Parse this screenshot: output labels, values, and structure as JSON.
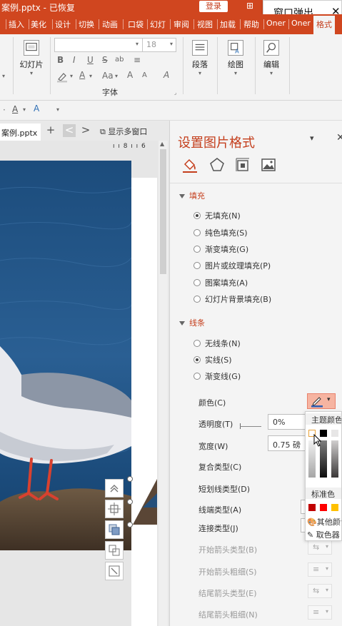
{
  "titlebar": {
    "document_title": "案例.pptx - 已恢复",
    "login_label": "登录",
    "restore_glyph": "⊞",
    "popup_label": "窗口弹出",
    "popup_close": "✕",
    "bg_color": "#d0461f"
  },
  "ribbon_tabs": [
    {
      "label": "插入"
    },
    {
      "label": "美化"
    },
    {
      "label": "设计"
    },
    {
      "label": "切换"
    },
    {
      "label": "动画"
    },
    {
      "label": "口袋"
    },
    {
      "label": "幻灯"
    },
    {
      "label": "审阅"
    },
    {
      "label": "视图"
    },
    {
      "label": "加载"
    },
    {
      "label": "帮助"
    },
    {
      "label": "Oner"
    },
    {
      "label": "Oner"
    },
    {
      "label": "格式"
    }
  ],
  "ribbon": {
    "slides_button": "幻灯片",
    "font_name_value": "",
    "font_size_value": "18",
    "font_group_label": "字体",
    "paragraph_button": "段落",
    "drawing_button": "绘图",
    "editing_button": "编辑",
    "bold": "B",
    "italic": "I",
    "underline": "U",
    "strike": "S",
    "shadow": "ab",
    "font_color": "A",
    "char_spacing": "Aa",
    "grow_font": "A",
    "shrink_font": "A",
    "clear_format": "A"
  },
  "doc_tabs": {
    "active_doc": "案例.pptx",
    "add_symbol": "+",
    "prev_symbol": "<",
    "next_symbol": ">",
    "multiwindow_label": "显示多窗口"
  },
  "ruler_text": "ı ı 8 ı ı 6",
  "panel": {
    "title": "设置图片格式",
    "dropdown_symbol": "▾",
    "close_symbol": "✕",
    "fill_section": "填充",
    "fill_options": [
      {
        "label": "无填充(N)",
        "selected": true
      },
      {
        "label": "纯色填充(S)",
        "selected": false
      },
      {
        "label": "渐变填充(G)",
        "selected": false
      },
      {
        "label": "图片或纹理填充(P)",
        "selected": false
      },
      {
        "label": "图案填充(A)",
        "selected": false
      },
      {
        "label": "幻灯片背景填充(B)",
        "selected": false
      }
    ],
    "line_section": "线条",
    "line_options": [
      {
        "label": "无线条(N)",
        "selected": false
      },
      {
        "label": "实线(S)",
        "selected": true
      },
      {
        "label": "渐变线(G)",
        "selected": false
      }
    ],
    "props": {
      "color": "颜色(C)",
      "transparency": "透明度(T)",
      "transparency_value": "0%",
      "width": "宽度(W)",
      "width_value": "0.75 磅",
      "compound": "复合类型(C)",
      "dash": "短划线类型(D)",
      "cap": "线端类型(A)",
      "join": "连接类型(J)",
      "begin_arrow_type": "开始箭头类型(B)",
      "begin_arrow_size": "开始箭头粗细(S)",
      "end_arrow_type": "结尾箭头类型(E)",
      "end_arrow_size": "结尾箭头粗细(N)"
    },
    "accent_color": "#c43e1c"
  },
  "palette": {
    "theme_colors_label": "主题颜色",
    "standard_colors_label": "标准色",
    "more_colors_label": "其他颜色",
    "eyedropper_label": "取色器",
    "standard_colors": [
      "#c00000",
      "#ff0000",
      "#ffc000"
    ],
    "theme_top_row": [
      "#ffffff",
      "#000000",
      "#e7e6e6"
    ]
  }
}
